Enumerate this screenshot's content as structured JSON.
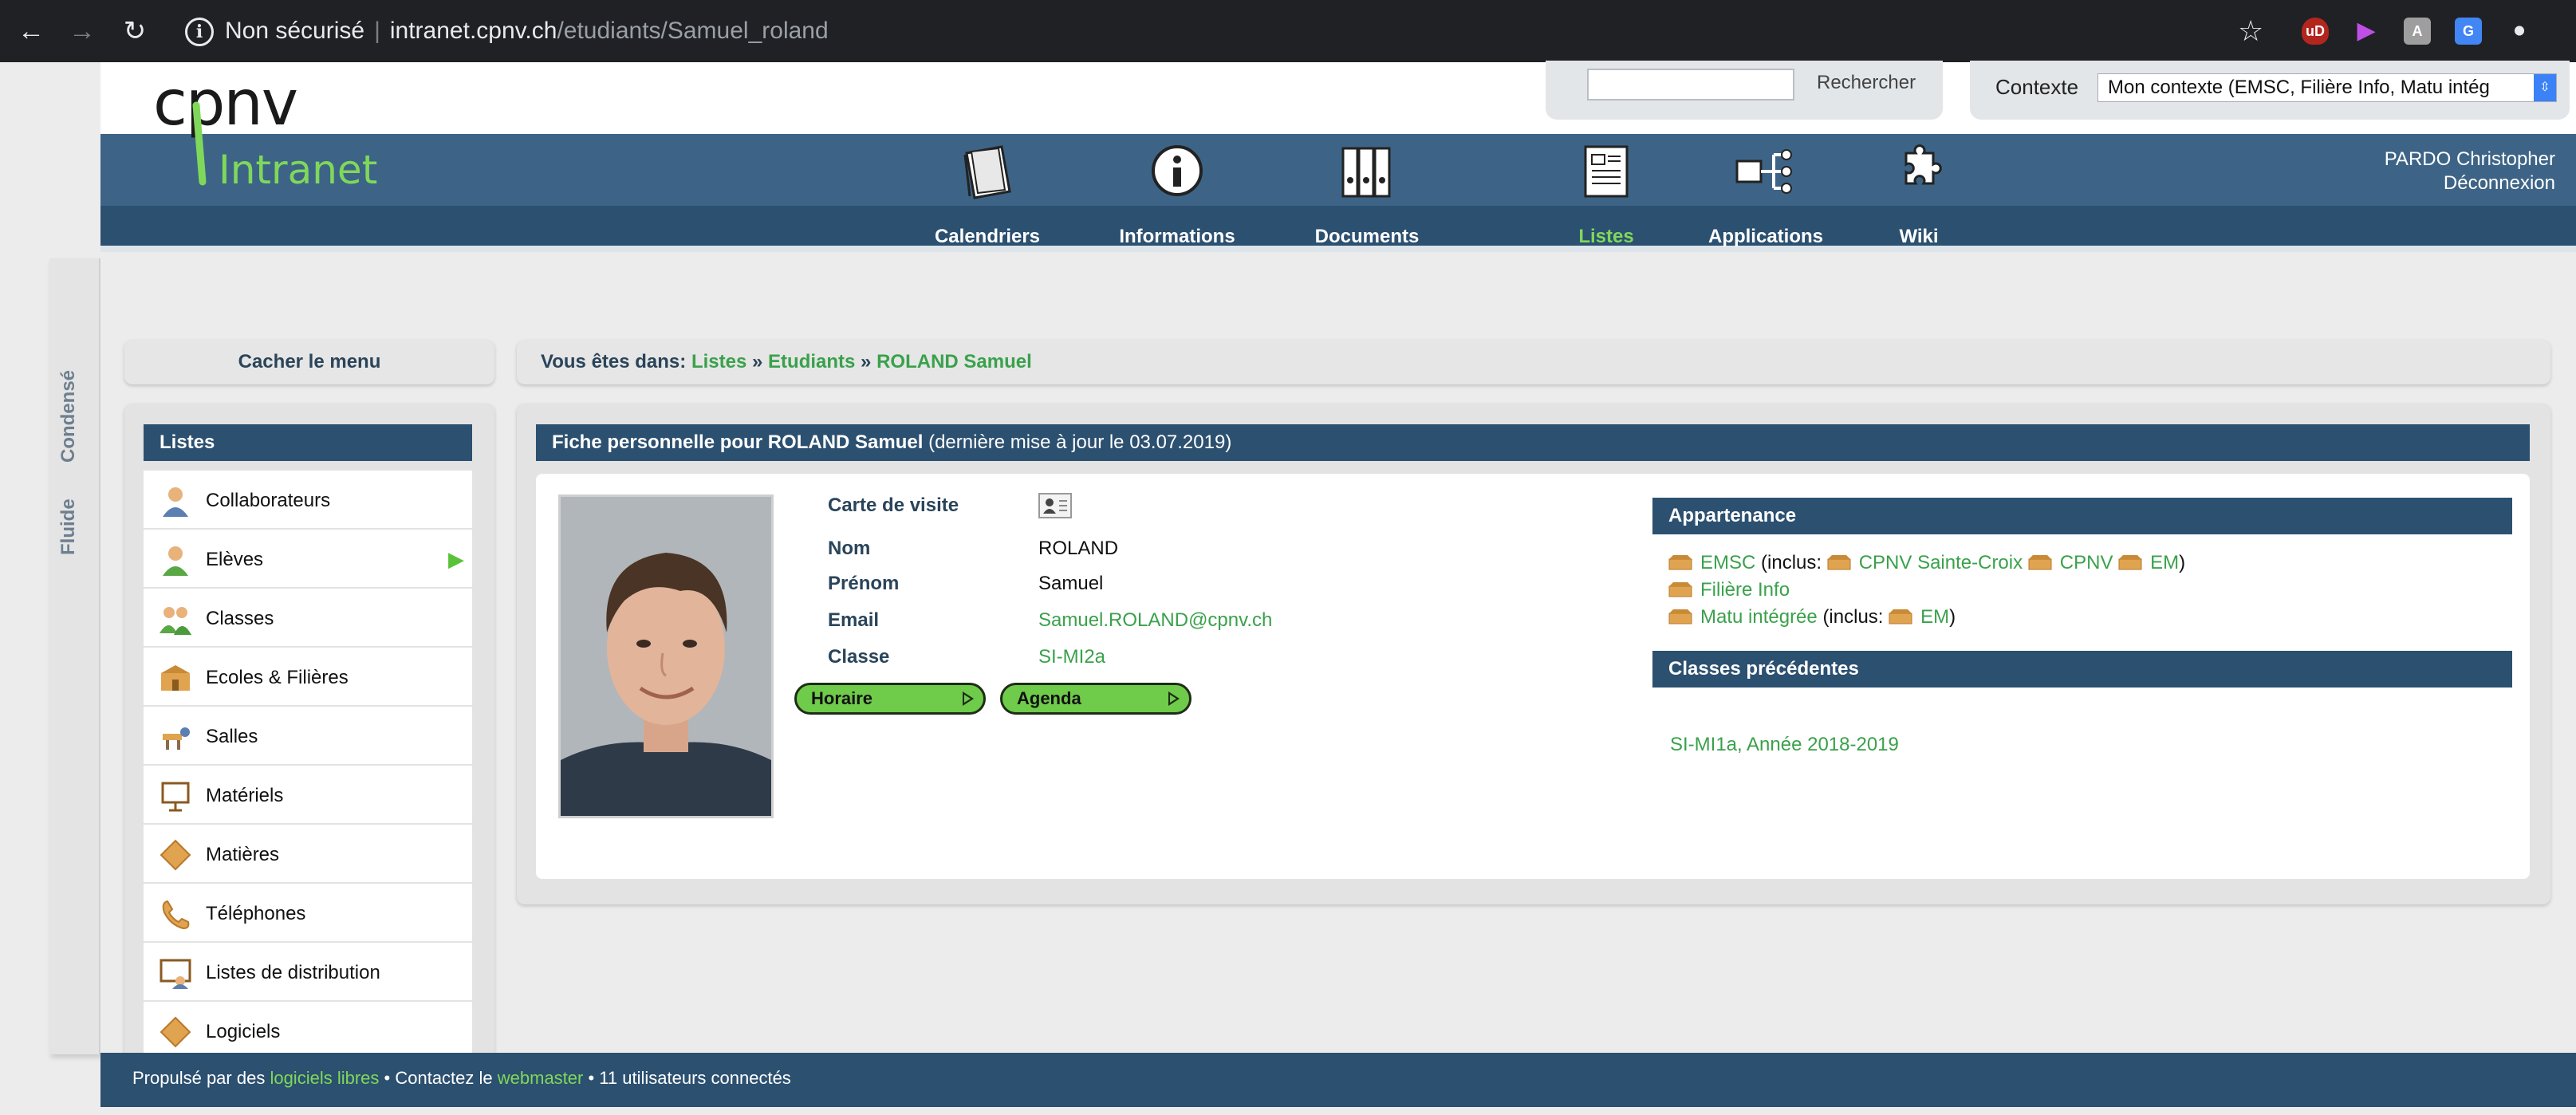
{
  "browser": {
    "security_label": "Non sécurisé",
    "url_host": "intranet.cpnv.ch",
    "url_path": "/etudiants/Samuel_roland"
  },
  "header": {
    "logo_text": "cpnv",
    "logo_subtext": "Intranet",
    "search_placeholder": "",
    "search_button": "Rechercher",
    "context_label": "Contexte",
    "context_value": "Mon contexte (EMSC, Filière Info, Matu intég",
    "user_name": "PARDO Christopher",
    "logout": "Déconnexion"
  },
  "nav": {
    "items": [
      {
        "label": "Calendriers",
        "icon": "calendar-icon"
      },
      {
        "label": "Informations",
        "icon": "info-icon"
      },
      {
        "label": "Documents",
        "icon": "binders-icon"
      },
      {
        "label": "Listes",
        "icon": "list-icon",
        "active": true
      },
      {
        "label": "Applications",
        "icon": "applications-icon"
      },
      {
        "label": "Wiki",
        "icon": "puzzle-icon"
      }
    ]
  },
  "side_tabs": {
    "condensed": "Condensé",
    "fluid": "Fluide"
  },
  "hide_menu": "Cacher le menu",
  "breadcrumb": {
    "prefix": "Vous êtes dans:",
    "sep": "»",
    "items": [
      "Listes",
      "Etudiants",
      "ROLAND Samuel"
    ]
  },
  "menu": {
    "title": "Listes",
    "items": [
      {
        "label": "Collaborateurs",
        "icon": "collaborator-icon"
      },
      {
        "label": "Elèves",
        "icon": "student-icon",
        "selected": true
      },
      {
        "label": "Classes",
        "icon": "class-group-icon"
      },
      {
        "label": "Ecoles & Filières",
        "icon": "school-icon"
      },
      {
        "label": "Salles",
        "icon": "room-icon"
      },
      {
        "label": "Matériels",
        "icon": "equipment-icon"
      },
      {
        "label": "Matières",
        "icon": "subject-icon"
      },
      {
        "label": "Téléphones",
        "icon": "phone-icon"
      },
      {
        "label": "Listes de distribution",
        "icon": "distribution-list-icon"
      },
      {
        "label": "Logiciels",
        "icon": "software-icon"
      }
    ]
  },
  "profile": {
    "title_bold": "Fiche personnelle pour ROLAND Samuel",
    "title_note": "(dernière mise à jour le 03.07.2019)",
    "labels": {
      "vcard": "Carte de visite",
      "nom": "Nom",
      "prenom": "Prénom",
      "email": "Email",
      "classe": "Classe"
    },
    "values": {
      "nom": "ROLAND",
      "prenom": "Samuel",
      "email": "Samuel.ROLAND@cpnv.ch",
      "classe": "SI-MI2a"
    },
    "buttons": {
      "horaire": "Horaire",
      "agenda": "Agenda"
    },
    "appartenance": {
      "title": "Appartenance",
      "emsc": "EMSC",
      "inclus_open": "(inclus:",
      "cpnv_sc": "CPNV Sainte-Croix",
      "cpnv": "CPNV",
      "em": "EM",
      "close": ")",
      "filiere": "Filière Info",
      "matu": "Matu intégrée",
      "matu_em": "EM"
    },
    "previous": {
      "title": "Classes précédentes",
      "item": "SI-MI1a, Année 2018-2019"
    }
  },
  "footer": {
    "t1": "Propulsé par des",
    "l1": "logiciels libres",
    "t2": "• Contactez le",
    "l2": "webmaster",
    "t3": "• 11 utilisateurs connectés"
  },
  "colors": {
    "navy": "#2c5070",
    "nav_blue": "#3d6486",
    "link_green": "#3aa14b",
    "active_green": "#7fd85a",
    "button_green": "#6fcb4a"
  }
}
